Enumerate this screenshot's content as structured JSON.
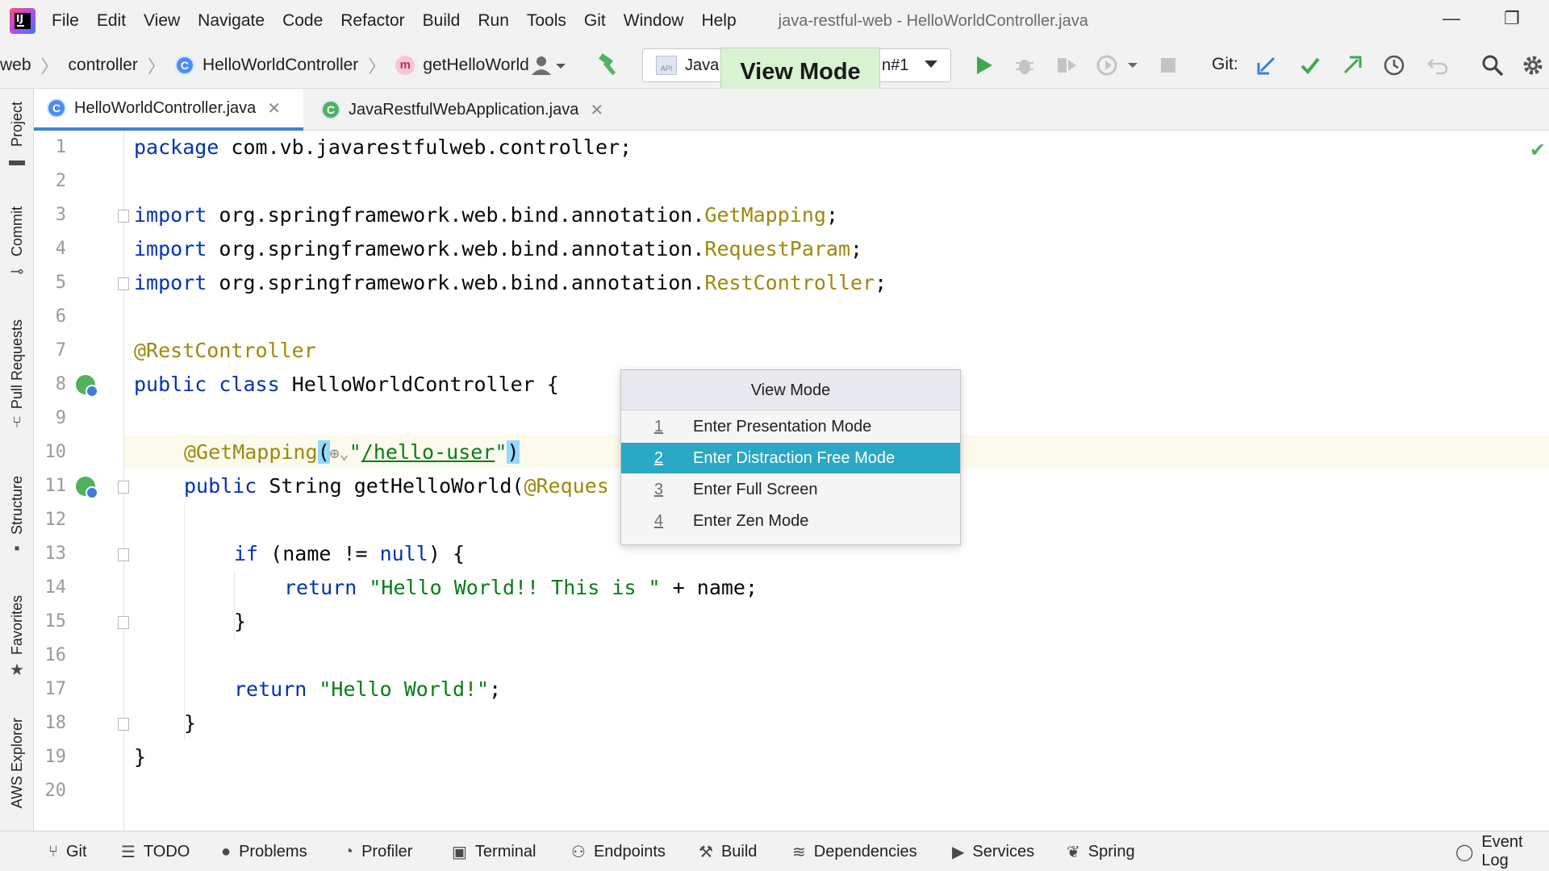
{
  "menubar": {
    "items": [
      "File",
      "Edit",
      "View",
      "Navigate",
      "Code",
      "Refactor",
      "Build",
      "Run",
      "Tools",
      "Git",
      "Window",
      "Help"
    ],
    "window_title": "java-restful-web - HelloWorldController.java",
    "logo_letters": "IJ"
  },
  "breadcrumb": {
    "project": "web",
    "package": "controller",
    "class": "HelloWorldController",
    "method": "getHelloWorld",
    "class_badge": "C",
    "method_badge": "m"
  },
  "toolbar": {
    "run_config_label": "Java",
    "run_config_suffix": "n#1",
    "run_config_icon": "API",
    "tooltip": "View Mode",
    "git_label": "Git:"
  },
  "colors": {
    "accent": "#2aa8c5",
    "keyword": "#0033b3",
    "annotation": "#9e880d",
    "string": "#067d17",
    "tooltip_bg": "#d9f2d2"
  },
  "tabs": [
    {
      "label": "HelloWorldController.java",
      "active": true
    },
    {
      "label": "JavaRestfulWebApplication.java",
      "active": false
    }
  ],
  "left_strip": [
    "Project",
    "Commit",
    "Pull Requests",
    "Structure",
    "Favorites",
    "AWS Explorer"
  ],
  "code": {
    "line_numbers": [
      "1",
      "2",
      "3",
      "4",
      "5",
      "6",
      "7",
      "8",
      "9",
      "10",
      "11",
      "12",
      "13",
      "14",
      "15",
      "16",
      "17",
      "18",
      "19",
      "20"
    ],
    "l1_kw": "package",
    "l1_rest": " com.vb.javarestfulweb.controller;",
    "l3_kw": "import",
    "l3_path": " org.springframework.web.bind.annotation.",
    "l3_cls": "GetMapping",
    "l4_cls": "RequestParam",
    "l5_cls": "RestController",
    "semi": ";",
    "l7_ann": "@RestController",
    "l8_kw1": "public",
    "l8_kw2": "class",
    "l8_rest": " HelloWorldController {",
    "l10_ann": "@GetMapping",
    "l10_open": "(",
    "l10_quote": "\"",
    "l10_path": "/hello-user",
    "l10_close": ")",
    "l11_kw": "public",
    "l11_rest": " String getHelloWorld(",
    "l11_ann": "@Reques",
    "l13_kw": "if",
    "l13_kw2": "null",
    "l13_rest1": " (name != ",
    "l13_rest2": ") {",
    "l14_kw": "return",
    "l14_str": "\"Hello World!! This is \"",
    "l14_rest": " + name;",
    "l15": "}",
    "l17_kw": "return",
    "l17_str": "\"Hello World!\"",
    "l18": "}",
    "l19": "}"
  },
  "popup": {
    "title": "View Mode",
    "items": [
      {
        "num": "1",
        "label": "Enter Presentation Mode"
      },
      {
        "num": "2",
        "label": "Enter Distraction Free Mode"
      },
      {
        "num": "3",
        "label": "Enter Full Screen"
      },
      {
        "num": "4",
        "label": "Enter Zen Mode"
      }
    ],
    "selected_index": 1
  },
  "bottombar": [
    "Git",
    "TODO",
    "Problems",
    "Profiler",
    "Terminal",
    "Endpoints",
    "Build",
    "Dependencies",
    "Services",
    "Spring",
    "Event Log"
  ]
}
